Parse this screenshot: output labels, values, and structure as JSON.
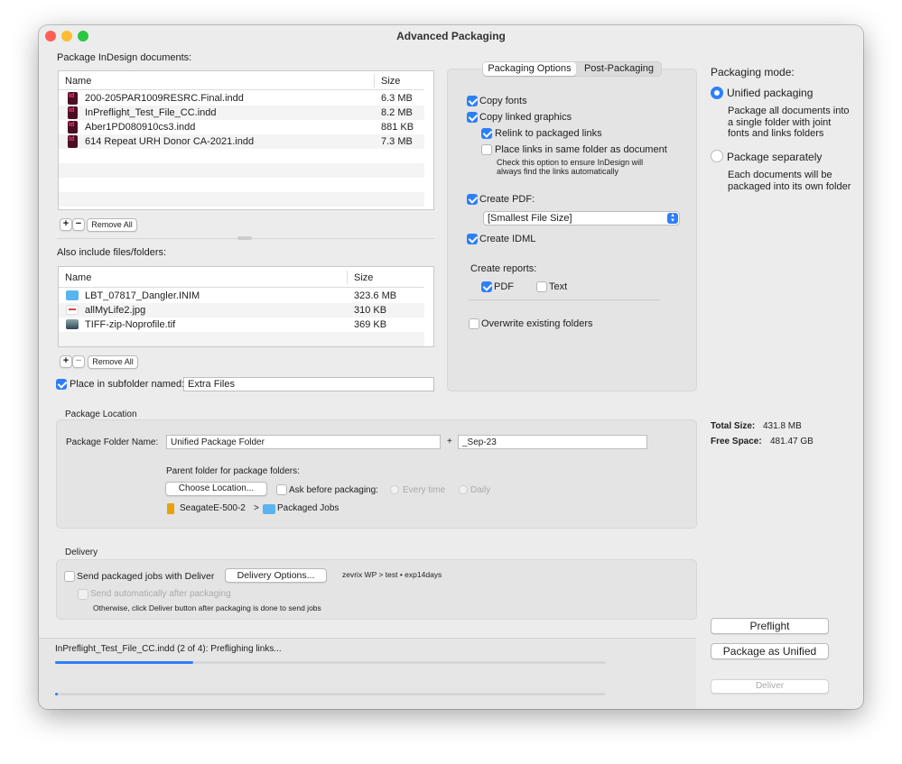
{
  "window": {
    "title": "Advanced Packaging"
  },
  "documents": {
    "label": "Package InDesign documents:",
    "columns": [
      "Name",
      "Size"
    ],
    "rows": [
      {
        "name": "200-205PAR1009RESRC.Final.indd",
        "size": "6.3 MB"
      },
      {
        "name": "InPreflight_Test_File_CC.indd",
        "size": "8.2 MB"
      },
      {
        "name": "Aber1PD080910cs3.indd",
        "size": "881 KB"
      },
      {
        "name": "614 Repeat URH Donor CA-2021.indd",
        "size": "7.3 MB"
      }
    ],
    "add": "+",
    "remove": "−",
    "remove_all": "Remove All"
  },
  "extra": {
    "label": "Also include files/folders:",
    "columns": [
      "Name",
      "Size"
    ],
    "rows": [
      {
        "name": "LBT_07817_Dangler.INIM",
        "size": "323.6 MB",
        "icon": "folder-icon"
      },
      {
        "name": "allMyLife2.jpg",
        "size": "310 KB",
        "icon": "jpg-file-icon"
      },
      {
        "name": "TIFF-zip-Noprofile.tif",
        "size": "369 KB",
        "icon": "tif-file-icon"
      }
    ],
    "add": "+",
    "remove": "−",
    "remove_all": "Remove All",
    "subfolder_label": "Place in subfolder named:",
    "subfolder_checked": true,
    "subfolder_value": "Extra Files"
  },
  "options": {
    "tabs": [
      "Packaging Options",
      "Post-Packaging"
    ],
    "active_tab": "Packaging Options",
    "copy_fonts": "Copy fonts",
    "copy_linked": "Copy linked graphics",
    "relink": "Relink to packaged links",
    "place_links": "Place links in same folder as document",
    "place_note1": "Check this option to ensure InDesign will",
    "place_note2": "always find the links automatically",
    "create_pdf": "Create PDF:",
    "pdf_preset": "[Smallest File Size]",
    "create_idml": "Create IDML",
    "reports_label": "Create reports:",
    "report_pdf": "PDF",
    "report_text": "Text",
    "overwrite": "Overwrite existing folders"
  },
  "mode": {
    "label": "Packaging mode:",
    "unified": "Unified packaging",
    "unified_desc": [
      "Package all documents into",
      "a single folder with joint",
      "fonts and links folders"
    ],
    "separate": "Package separately",
    "separate_desc": [
      "Each documents will be",
      "packaged into its own folder"
    ],
    "selected": "Unified packaging"
  },
  "sizes": {
    "total_label": "Total Size:",
    "total": "431.8 MB",
    "free_label": "Free Space:",
    "free": "481.47 GB"
  },
  "location": {
    "section": "Package Location",
    "folder_label": "Package Folder Name:",
    "folder_value": "Unified Package Folder",
    "plus": "+",
    "suffix_value": "_Sep-23",
    "parent_label": "Parent folder for package folders:",
    "choose": "Choose Location...",
    "ask": "Ask before packaging:",
    "every_time": "Every time",
    "daily": "Daily",
    "path_drive": "SeagateE-500-2",
    "path_sep": ">",
    "path_folder": "Packaged Jobs"
  },
  "delivery": {
    "section": "Delivery",
    "send": "Send packaged jobs with Deliver",
    "options": "Delivery Options...",
    "target": "zevrix WP > test • exp14days",
    "auto": "Send automatically after packaging",
    "note": "Otherwise, click Deliver button after packaging is done to send jobs"
  },
  "status": {
    "text": "InPreflight_Test_File_CC.indd (2 of 4): Preflighing links...",
    "progress1": 25,
    "progress2": 0.5
  },
  "actions": {
    "preflight": "Preflight",
    "package": "Package as Unified",
    "deliver": "Deliver"
  },
  "colors": {
    "accent": "#2d7ff9"
  }
}
